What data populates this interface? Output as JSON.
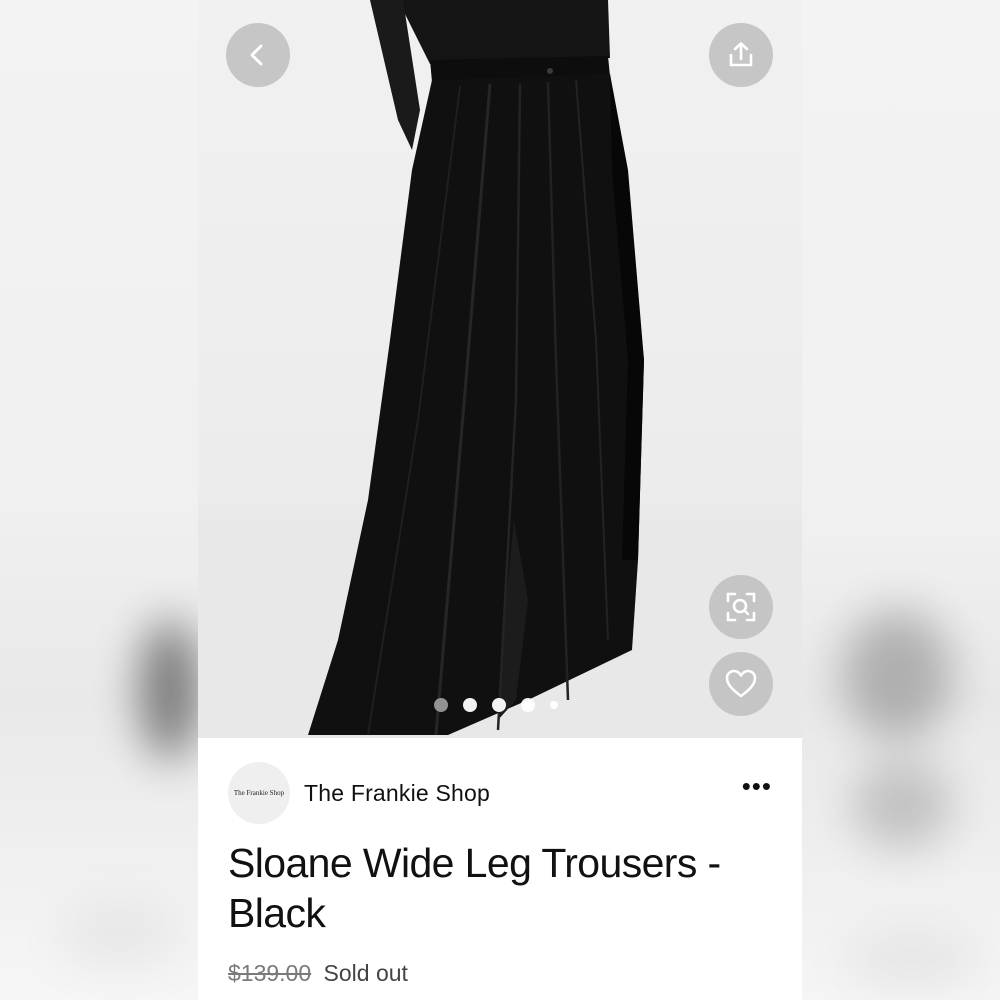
{
  "header": {
    "back_icon": "chevron-left-icon",
    "share_icon": "share-icon"
  },
  "gallery": {
    "image_subject": "black-wide-leg-trousers-photo",
    "visual_search_icon": "visual-search-icon",
    "favorite_icon": "heart-icon",
    "slide_count": 5,
    "active_slide": 0
  },
  "shop": {
    "logo_text": "The Frankie Shop",
    "name": "The Frankie Shop",
    "more_icon": "more-dots-icon",
    "more_label": "•••"
  },
  "product": {
    "title": "Sloane Wide Leg Trousers - Black",
    "original_price": "$139.00",
    "status": "Sold out"
  },
  "colors": {
    "text": "#111111",
    "muted": "#6e6e6e",
    "button_bg": "#bebebe"
  }
}
